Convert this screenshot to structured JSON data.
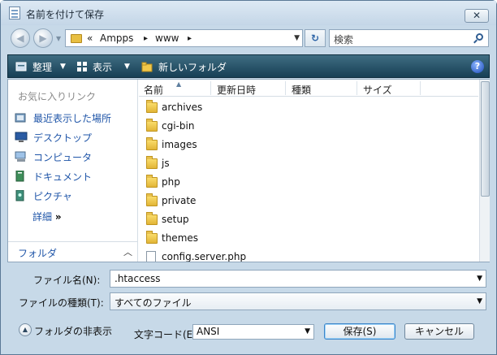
{
  "window": {
    "title": "名前を付けて保存",
    "close_label": "✕"
  },
  "nav": {
    "back_glyph": "◀",
    "forward_glyph": "▶",
    "breadcrumb": [
      "«",
      "Ampps",
      "▸",
      "www",
      "▸"
    ],
    "search_placeholder": "検索"
  },
  "toolbar": {
    "organize_label": "整理",
    "views_label": "表示",
    "new_folder_label": "新しいフォルダ",
    "help_label": "?"
  },
  "favorites": {
    "title": "お気に入りリンク",
    "items": [
      {
        "label": "最近表示した場所",
        "icon": "recent-places-icon"
      },
      {
        "label": "デスクトップ",
        "icon": "desktop-icon"
      },
      {
        "label": "コンピュータ",
        "icon": "computer-icon"
      },
      {
        "label": "ドキュメント",
        "icon": "documents-icon"
      },
      {
        "label": "ピクチャ",
        "icon": "pictures-icon"
      }
    ],
    "more_label": "詳細",
    "more_glyph": "»",
    "folder_pane_label": "フォルダ",
    "folder_pane_glyph": "︿"
  },
  "file_list": {
    "columns": [
      "名前",
      "更新日時",
      "種類",
      "サイズ"
    ],
    "items": [
      {
        "name": "archives",
        "kind": "folder"
      },
      {
        "name": "cgi-bin",
        "kind": "folder"
      },
      {
        "name": "images",
        "kind": "folder"
      },
      {
        "name": "js",
        "kind": "folder"
      },
      {
        "name": "php",
        "kind": "folder"
      },
      {
        "name": "private",
        "kind": "folder"
      },
      {
        "name": "setup",
        "kind": "folder"
      },
      {
        "name": "themes",
        "kind": "folder"
      },
      {
        "name": "config.server.php",
        "kind": "file"
      }
    ]
  },
  "form": {
    "filename_label": "ファイル名(N):",
    "filename_value": ".htaccess",
    "filetype_label": "ファイルの種類(T):",
    "filetype_value": "すべてのファイル",
    "hide_folders_label": "フォルダの非表示",
    "encoding_label": "文字コード(E):",
    "encoding_value": "ANSI",
    "save_label": "保存(S)",
    "cancel_label": "キャンセル"
  },
  "colors": {
    "link": "#1f55a8",
    "toolbar": "#173f55",
    "folder": "#e2b537"
  }
}
